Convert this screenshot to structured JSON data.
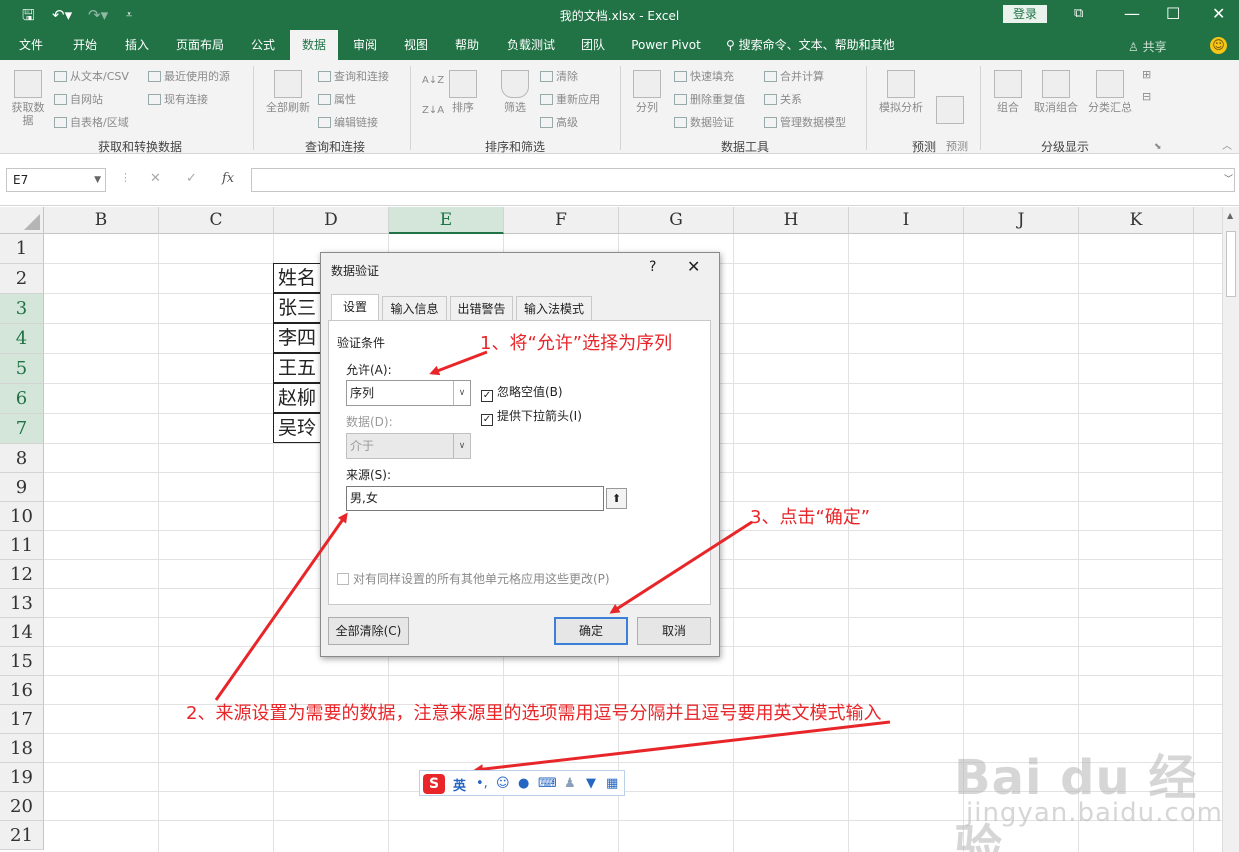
{
  "titlebar": {
    "save_icon": "save-icon",
    "undo_icon": "undo-icon",
    "redo_icon": "redo-icon",
    "customize_icon": "customize-qat-icon",
    "filename": "我的文档.xlsx",
    "separator": "-",
    "app": "Excel",
    "login": "登录",
    "ribbon_display_icon": "ribbon-display-icon",
    "minimize": "—",
    "maximize": "☐",
    "close": "✕"
  },
  "tabs": [
    "文件",
    "开始",
    "插入",
    "页面布局",
    "公式",
    "数据",
    "审阅",
    "视图",
    "帮助",
    "负载测试",
    "团队",
    "Power Pivot"
  ],
  "active_tab": "数据",
  "search_hint": "搜索命令、文本、帮助和其他",
  "share": "共享",
  "ribbon": {
    "get_data": "获取数据",
    "from_text_csv": "从文本/CSV",
    "from_web": "自网站",
    "from_table": "自表格/区域",
    "recent_sources": "最近使用的源",
    "existing_connections": "现有连接",
    "group_get_transform": "获取和转换数据",
    "refresh_all": "全部刷新",
    "queries_connections": "查询和连接",
    "properties": "属性",
    "edit_links": "编辑链接",
    "group_queries": "查询和连接",
    "sort_az": "A↓Z",
    "sort_za": "Z↓A",
    "sort": "排序",
    "filter": "筛选",
    "clear": "清除",
    "reapply": "重新应用",
    "advanced": "高级",
    "group_sort_filter": "排序和筛选",
    "split": "分列",
    "flash_fill": "快速填充",
    "remove_dup": "删除重复值",
    "data_validation": "数据验证",
    "consolidate": "合并计算",
    "relationships": "关系",
    "manage_model": "管理数据模型",
    "group_data_tools": "数据工具",
    "what_if": "模拟分析",
    "forecast_sheet": "预测\n工作表",
    "group_forecast": "预测",
    "group": "组合",
    "ungroup": "取消组合",
    "subtotal": "分类汇总",
    "group_outline": "分级显示"
  },
  "formula_bar": {
    "name_box": "E7",
    "cancel": "✕",
    "enter": "✓",
    "fx": "fx",
    "value": ""
  },
  "grid": {
    "columns": [
      "B",
      "C",
      "D",
      "E",
      "F",
      "G",
      "H",
      "I",
      "J",
      "K"
    ],
    "selected_column": "E",
    "rows": [
      "1",
      "2",
      "3",
      "4",
      "5",
      "6",
      "7",
      "8",
      "9",
      "10",
      "11",
      "12",
      "13",
      "14",
      "15",
      "16",
      "17",
      "18",
      "19",
      "20",
      "21"
    ],
    "selected_rows": [
      "3",
      "4",
      "5",
      "6",
      "7"
    ],
    "names": [
      "姓名",
      "张三",
      "李四",
      "王五",
      "赵柳",
      "吴玲"
    ]
  },
  "dialog": {
    "title": "数据验证",
    "help": "?",
    "close": "✕",
    "tabs": [
      "设置",
      "输入信息",
      "出错警告",
      "输入法模式"
    ],
    "section": "验证条件",
    "allow_label": "允许(A):",
    "allow_value": "序列",
    "ignore_blank": "忽略空值(B)",
    "dropdown": "提供下拉箭头(I)",
    "data_label": "数据(D):",
    "data_value": "介于",
    "source_label": "来源(S):",
    "source_value": "男,女",
    "apply_all": "对有同样设置的所有其他单元格应用这些更改(P)",
    "clear_all": "全部清除(C)",
    "ok": "确定",
    "cancel": "取消"
  },
  "annotations": {
    "a1": "1、将“允许”选择为序列",
    "a2": "2、来源设置为需要的数据，注意来源里的选项需用逗号分隔并且逗号要用英文模式输入",
    "a3": "3、点击“确定”"
  },
  "ime": {
    "logo": "S",
    "mode": "英",
    "punct": "•,",
    "emoji": "☺",
    "mic": "●",
    "keyboard": "⌨",
    "user": "♟",
    "skin": "▼",
    "grid": "▦"
  },
  "watermark": {
    "logo": "Bai du 经验",
    "url": "jingyan.baidu.com"
  },
  "colors": {
    "excel_green": "#217346",
    "annotation_red": "#e8262a",
    "ok_border": "#3c7fd8"
  }
}
